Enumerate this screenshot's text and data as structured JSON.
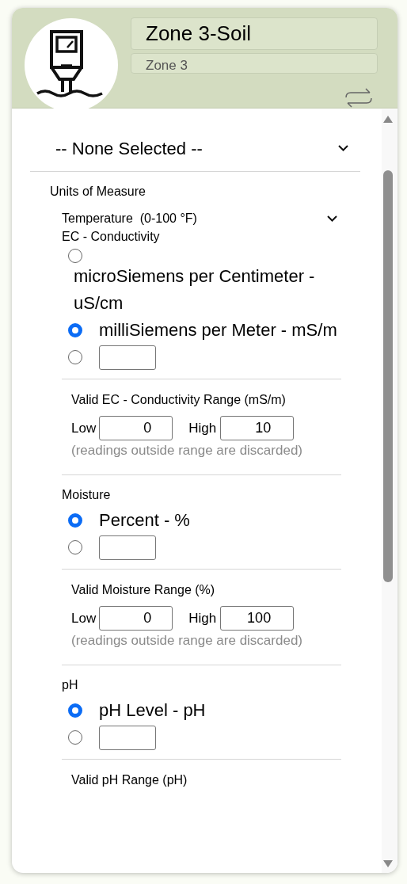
{
  "header": {
    "title": "Zone 3-Soil",
    "subtitle": "Zone 3"
  },
  "zone_select": {
    "value": "-- None Selected --"
  },
  "units_heading": "Units of Measure",
  "temperature_select": {
    "value": "Temperature  (0-100 °F)"
  },
  "sections": [
    {
      "heading": "EC - Conductivity",
      "options": [
        {
          "kind": "label",
          "label": "microSiemens per Centimeter - uS/cm",
          "selected": false
        },
        {
          "kind": "label",
          "label": "milliSiemens per Meter - mS/m",
          "selected": true
        },
        {
          "kind": "custom",
          "selected": false
        }
      ],
      "range": {
        "title": "Valid EC - Conductivity Range (mS/m)",
        "low_label": "Low",
        "low": "0",
        "high_label": "High",
        "high": "10",
        "note": "(readings outside range are discarded)"
      }
    },
    {
      "heading": "Moisture",
      "options": [
        {
          "kind": "label",
          "label": "Percent - %",
          "selected": true
        },
        {
          "kind": "custom",
          "selected": false
        }
      ],
      "range": {
        "title": "Valid Moisture Range (%)",
        "low_label": "Low",
        "low": "0",
        "high_label": "High",
        "high": "100",
        "note": "(readings outside range are discarded)"
      }
    },
    {
      "heading": "pH",
      "options": [
        {
          "kind": "label",
          "label": "pH Level - pH",
          "selected": true
        },
        {
          "kind": "custom",
          "selected": false
        }
      ],
      "range": {
        "title": "Valid pH Range (pH)"
      }
    }
  ]
}
